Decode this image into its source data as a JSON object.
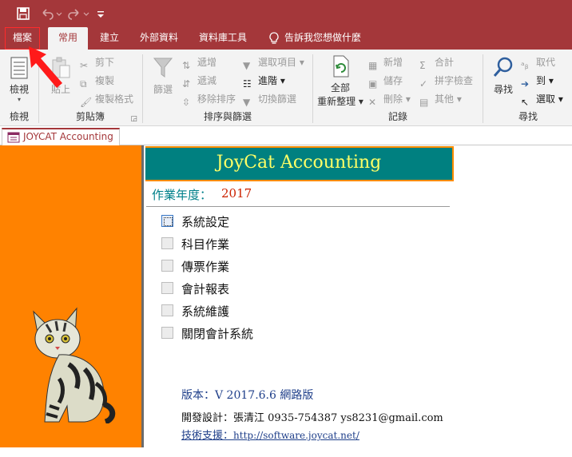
{
  "quick_access": {
    "save_icon": "save-icon",
    "undo_icon": "undo-icon",
    "redo_icon": "redo-icon",
    "customize_icon": "customize-qat-icon"
  },
  "tabs": {
    "file": "檔案",
    "home": "常用",
    "create": "建立",
    "external": "外部資料",
    "dbtools": "資料庫工具",
    "tell_me": "告訴我您想做什麼"
  },
  "ribbon": {
    "views": {
      "view_button": "檢視",
      "group_label": "檢視"
    },
    "clipboard": {
      "paste": "貼上",
      "cut": "剪下",
      "copy": "複製",
      "format_painter": "複製格式",
      "group_label": "剪貼簿"
    },
    "sort_filter": {
      "filter": "篩選",
      "ascending": "遞增",
      "descending": "遞減",
      "remove_sort": "移除排序",
      "selection": "選取項目",
      "advanced": "進階",
      "toggle_filter": "切換篩選",
      "group_label": "排序與篩選"
    },
    "records": {
      "refresh_all_line1": "全部",
      "refresh_all_line2": "重新整理",
      "new": "新增",
      "save": "儲存",
      "delete": "刪除",
      "totals": "合計",
      "spelling": "拼字檢查",
      "more": "其他",
      "group_label": "記錄"
    },
    "find": {
      "find": "尋找",
      "replace": "取代",
      "goto": "到",
      "select": "選取",
      "group_label": "尋找"
    }
  },
  "document_tab": {
    "label": "JOYCAT Accounting"
  },
  "form": {
    "banner_title": "JoyCat Accounting",
    "year_label": "作業年度：",
    "year_value": "2017",
    "menu": [
      {
        "label": "系統設定",
        "active": true
      },
      {
        "label": "科目作業",
        "active": false
      },
      {
        "label": "傳票作業",
        "active": false
      },
      {
        "label": "會計報表",
        "active": false
      },
      {
        "label": "系統維護",
        "active": false
      },
      {
        "label": "關閉會計系統",
        "active": false
      }
    ],
    "version": "版本：V 2017.6.6 網路版",
    "developer": "開發設計：張清江  0935-754387  ys8231@gmail.com",
    "support_label": "技術支援：",
    "support_url": "http://software.joycat.net/"
  },
  "colors": {
    "title_bar": "#a4373a",
    "left_panel": "#ff8200",
    "banner_bg": "#008080",
    "banner_text": "#ffff66",
    "year_label": "#00808a",
    "year_value": "#cc2200"
  }
}
